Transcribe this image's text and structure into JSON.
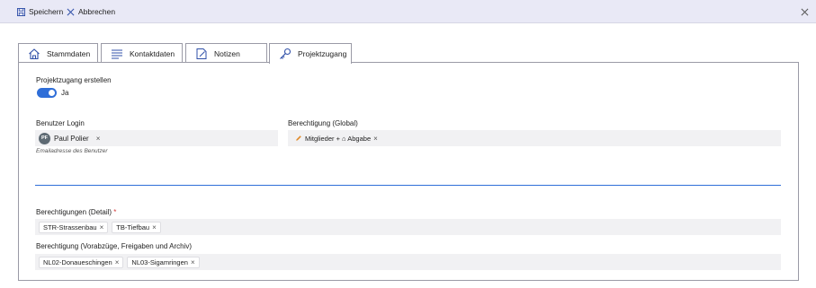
{
  "toolbar": {
    "save_label": "Speichern",
    "cancel_label": "Abbrechen"
  },
  "tabs": [
    {
      "label": "Stammdaten",
      "icon": "home-icon"
    },
    {
      "label": "Kontaktdaten",
      "icon": "list-icon"
    },
    {
      "label": "Notizen",
      "icon": "note-icon"
    },
    {
      "label": "Projektzugang",
      "icon": "key-icon"
    }
  ],
  "active_tab": "Projektzugang",
  "form": {
    "create_access_label": "Projektzugang erstellen",
    "create_access_toggle_text": "Ja",
    "create_access_value": true,
    "login_label": "Benutzer Login",
    "login_user": {
      "initials": "PF",
      "name": "Paul Polier"
    },
    "login_hint": "Emailadresse des Benutzer",
    "global_perm_label": "Berechtigung (Global)",
    "global_perm_value": "Mitglieder + ⌂ Abgabe",
    "detail_perm_label": "Berechtigungen (Detail)",
    "required_mark": "*",
    "detail_perm_values": [
      "STR-Strassenbau",
      "TB-Tiefbau"
    ],
    "archive_perm_label": "Berechtigung (Vorabzüge, Freigaben und Archiv)",
    "archive_perm_values": [
      "NL02-Donaueschingen",
      "NL03-Sigamringen"
    ],
    "remove_glyph": "×"
  },
  "colors": {
    "accent": "#2f6ed8",
    "toolbar_bg": "#e9e9f6",
    "field_bg": "#f1f1f3",
    "required": "#d23b3b"
  }
}
